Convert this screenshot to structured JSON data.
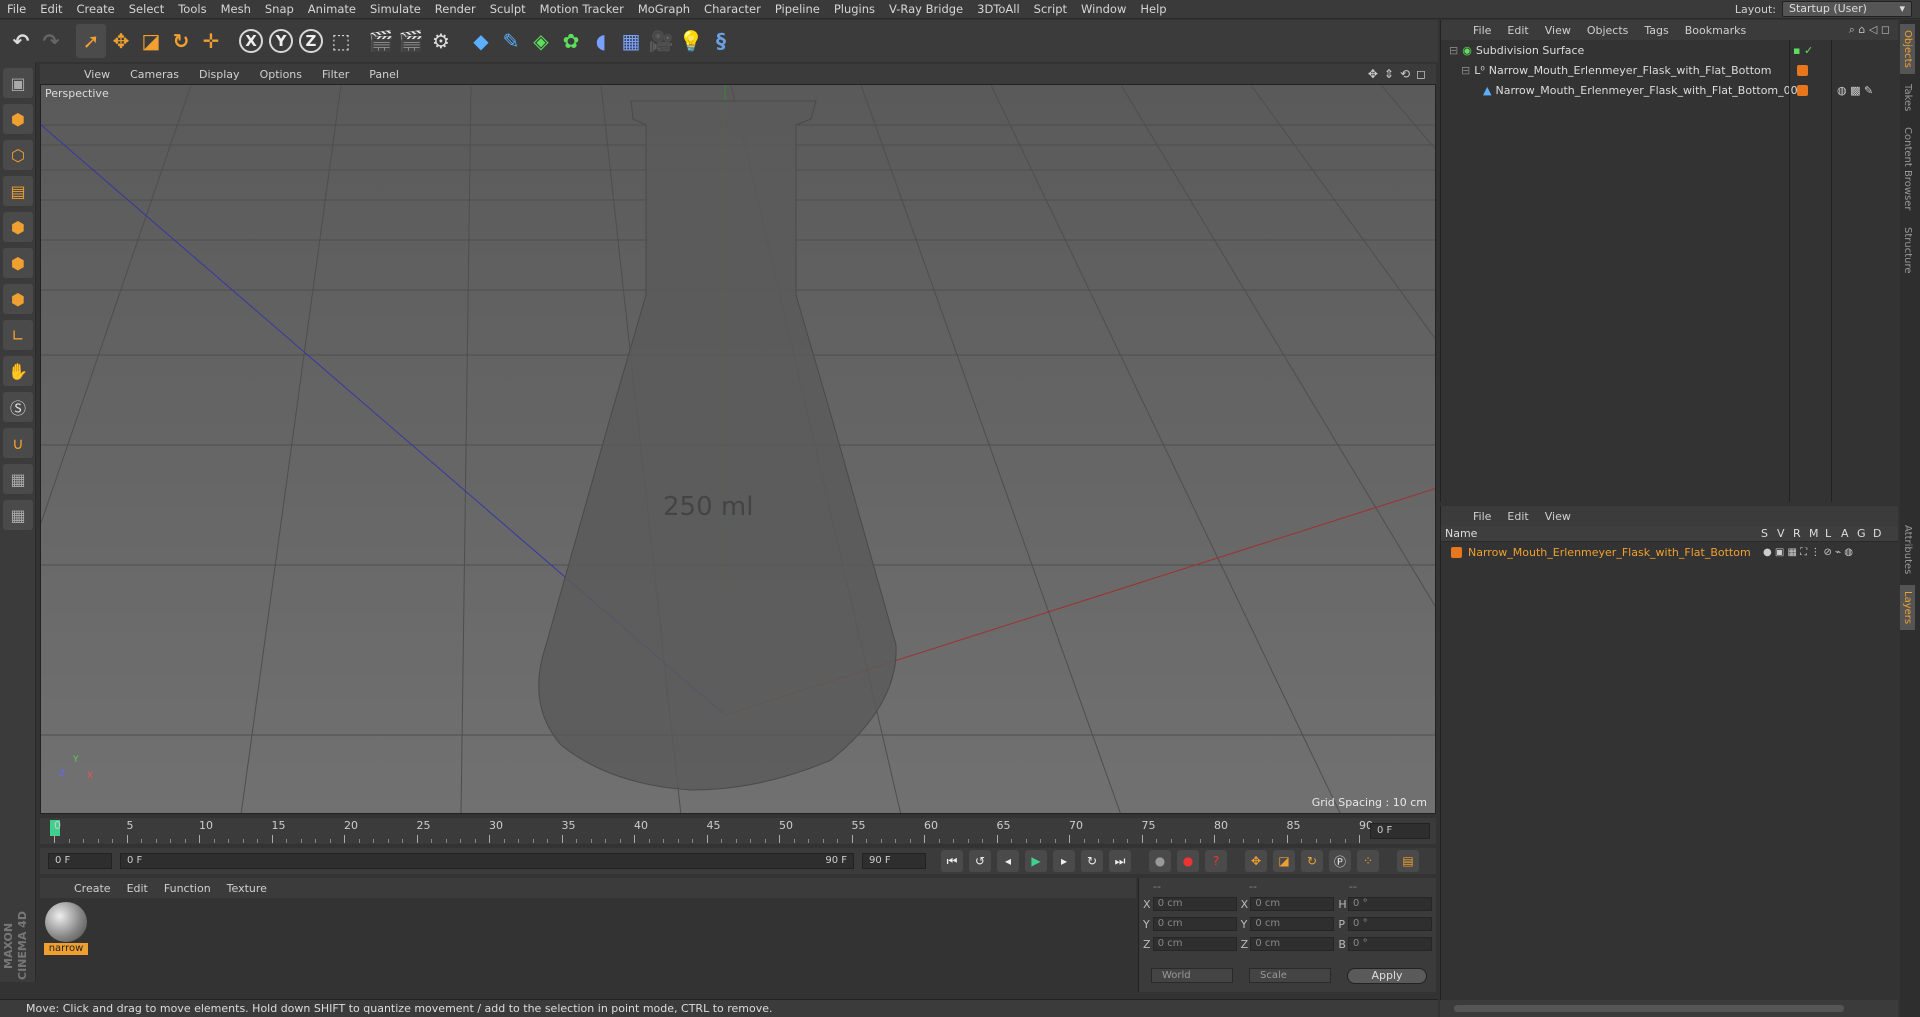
{
  "menubar": {
    "items": [
      "File",
      "Edit",
      "Create",
      "Select",
      "Tools",
      "Mesh",
      "Snap",
      "Animate",
      "Simulate",
      "Render",
      "Sculpt",
      "Motion Tracker",
      "MoGraph",
      "Character",
      "Pipeline",
      "Plugins",
      "V-Ray Bridge",
      "3DToAll",
      "Script",
      "Window",
      "Help"
    ],
    "layout_label": "Layout:",
    "layout_value": "Startup (User)"
  },
  "viewport": {
    "menu": [
      "View",
      "Cameras",
      "Display",
      "Options",
      "Filter",
      "Panel"
    ],
    "label": "Perspective",
    "grid_spacing": "Grid Spacing : 10 cm",
    "flask_text": "250 ml",
    "axis_y": "Y",
    "axis_z": "Z",
    "axis_x": "X"
  },
  "timeline": {
    "ticks": [
      "0",
      "5",
      "10",
      "15",
      "20",
      "25",
      "30",
      "35",
      "40",
      "45",
      "50",
      "55",
      "60",
      "65",
      "70",
      "75",
      "80",
      "85",
      "90"
    ],
    "current_frame": "0 F",
    "start_field": "0 F",
    "range_start": "0 F",
    "range_end": "90 F",
    "end_field": "90 F"
  },
  "material_manager": {
    "menu": [
      "Create",
      "Edit",
      "Function",
      "Texture"
    ],
    "material_name": "narrow"
  },
  "coordinates": {
    "headers": [
      "--",
      "--",
      "--"
    ],
    "rows": [
      {
        "a": "X",
        "av": "0 cm",
        "b": "X",
        "bv": "0 cm",
        "c": "H",
        "cv": "0 °"
      },
      {
        "a": "Y",
        "av": "0 cm",
        "b": "Y",
        "bv": "0 cm",
        "c": "P",
        "cv": "0 °"
      },
      {
        "a": "Z",
        "av": "0 cm",
        "b": "Z",
        "bv": "0 cm",
        "c": "B",
        "cv": "0 °"
      }
    ],
    "world": "World",
    "scale": "Scale",
    "apply": "Apply"
  },
  "objects_panel": {
    "menu": [
      "File",
      "Edit",
      "View",
      "Objects",
      "Tags",
      "Bookmarks"
    ],
    "items": [
      {
        "name": "Subdivision Surface"
      },
      {
        "name": "Narrow_Mouth_Erlenmeyer_Flask_with_Flat_Bottom"
      },
      {
        "name": "Narrow_Mouth_Erlenmeyer_Flask_with_Flat_Bottom_001"
      }
    ]
  },
  "layers_panel": {
    "menu": [
      "File",
      "Edit",
      "View"
    ],
    "header_name": "Name",
    "columns": [
      "S",
      "V",
      "R",
      "M",
      "L",
      "A",
      "G",
      "D"
    ],
    "layer_name": "Narrow_Mouth_Erlenmeyer_Flask_with_Flat_Bottom"
  },
  "right_tabs": [
    "Objects",
    "Takes",
    "Content Browser",
    "Structure",
    "Attributes",
    "Layers"
  ],
  "status": "Move: Click and drag to move elements. Hold down SHIFT to quantize movement / add to the selection in point mode, CTRL to remove.",
  "brand": "MAXON CINEMA 4D",
  "colors": {
    "accent": "#f0a030",
    "layer": "#e8761c"
  }
}
